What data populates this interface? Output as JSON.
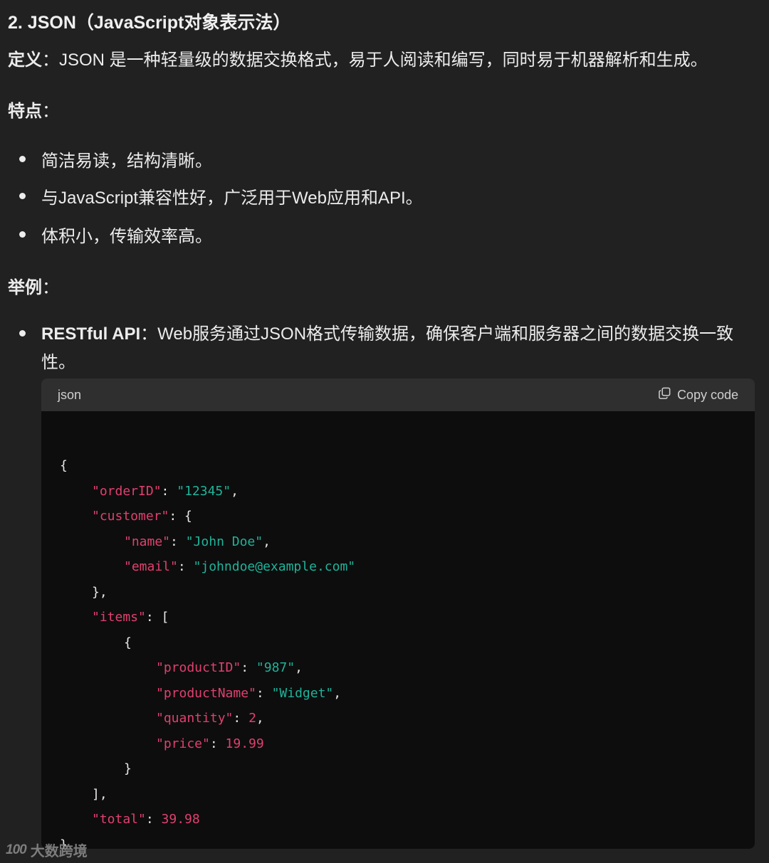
{
  "heading": "2. JSON（JavaScript对象表示法）",
  "definition": {
    "label": "定义",
    "sep": "：",
    "text": "JSON 是一种轻量级的数据交换格式，易于人阅读和编写，同时易于机器解析和生成。"
  },
  "features": {
    "label": "特点",
    "sep": "：",
    "items": [
      "简洁易读，结构清晰。",
      "与JavaScript兼容性好，广泛用于Web应用和API。",
      "体积小，传输效率高。"
    ]
  },
  "examples": {
    "label": "举例",
    "sep": "：",
    "item_label": "RESTful API",
    "item_sep": "：",
    "item_text": "Web服务通过JSON格式传输数据，确保客户端和服务器之间的数据交换一致性。"
  },
  "code": {
    "language": "json",
    "copy_label": "Copy code",
    "lines": [
      {
        "indent": 0,
        "tokens": [
          {
            "t": "p",
            "v": "{"
          }
        ]
      },
      {
        "indent": 1,
        "tokens": [
          {
            "t": "k",
            "v": "\"orderID\""
          },
          {
            "t": "p",
            "v": ": "
          },
          {
            "t": "s",
            "v": "\"12345\""
          },
          {
            "t": "p",
            "v": ","
          }
        ]
      },
      {
        "indent": 1,
        "tokens": [
          {
            "t": "k",
            "v": "\"customer\""
          },
          {
            "t": "p",
            "v": ": {"
          }
        ]
      },
      {
        "indent": 2,
        "tokens": [
          {
            "t": "k",
            "v": "\"name\""
          },
          {
            "t": "p",
            "v": ": "
          },
          {
            "t": "s",
            "v": "\"John Doe\""
          },
          {
            "t": "p",
            "v": ","
          }
        ]
      },
      {
        "indent": 2,
        "tokens": [
          {
            "t": "k",
            "v": "\"email\""
          },
          {
            "t": "p",
            "v": ": "
          },
          {
            "t": "s",
            "v": "\"johndoe@example.com\""
          }
        ]
      },
      {
        "indent": 1,
        "tokens": [
          {
            "t": "p",
            "v": "},"
          }
        ]
      },
      {
        "indent": 1,
        "tokens": [
          {
            "t": "k",
            "v": "\"items\""
          },
          {
            "t": "p",
            "v": ": ["
          }
        ]
      },
      {
        "indent": 2,
        "tokens": [
          {
            "t": "p",
            "v": "{"
          }
        ]
      },
      {
        "indent": 3,
        "tokens": [
          {
            "t": "k",
            "v": "\"productID\""
          },
          {
            "t": "p",
            "v": ": "
          },
          {
            "t": "s",
            "v": "\"987\""
          },
          {
            "t": "p",
            "v": ","
          }
        ]
      },
      {
        "indent": 3,
        "tokens": [
          {
            "t": "k",
            "v": "\"productName\""
          },
          {
            "t": "p",
            "v": ": "
          },
          {
            "t": "s",
            "v": "\"Widget\""
          },
          {
            "t": "p",
            "v": ","
          }
        ]
      },
      {
        "indent": 3,
        "tokens": [
          {
            "t": "k",
            "v": "\"quantity\""
          },
          {
            "t": "p",
            "v": ": "
          },
          {
            "t": "n",
            "v": "2"
          },
          {
            "t": "p",
            "v": ","
          }
        ]
      },
      {
        "indent": 3,
        "tokens": [
          {
            "t": "k",
            "v": "\"price\""
          },
          {
            "t": "p",
            "v": ": "
          },
          {
            "t": "n",
            "v": "19.99"
          }
        ]
      },
      {
        "indent": 2,
        "tokens": [
          {
            "t": "p",
            "v": "}"
          }
        ]
      },
      {
        "indent": 1,
        "tokens": [
          {
            "t": "p",
            "v": "],"
          }
        ]
      },
      {
        "indent": 1,
        "tokens": [
          {
            "t": "k",
            "v": "\"total\""
          },
          {
            "t": "p",
            "v": ": "
          },
          {
            "t": "n",
            "v": "39.98"
          }
        ]
      },
      {
        "indent": 0,
        "tokens": [
          {
            "t": "p",
            "v": "}"
          }
        ]
      }
    ]
  },
  "watermark": {
    "logo": "100",
    "text": "大数跨境"
  },
  "colors": {
    "background": "#212121",
    "code_background": "#0d0d0d",
    "code_header": "#2f2f2f",
    "json_key": "#e0406f",
    "json_string": "#1fb39a",
    "json_number": "#e0406f"
  }
}
